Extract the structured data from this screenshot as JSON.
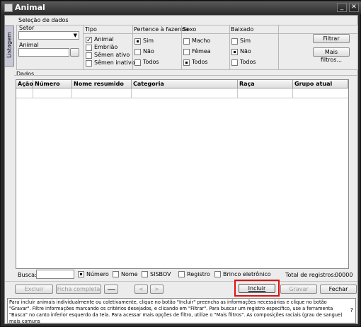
{
  "window": {
    "title": "Animal",
    "minimize": "_",
    "close": "✕"
  },
  "sidetab": {
    "label": "Listagem"
  },
  "selection": {
    "title": "Seleção de dados"
  },
  "setor": {
    "label": "Setor",
    "value": ""
  },
  "animal": {
    "label": "Animal",
    "value": ""
  },
  "tipo": {
    "label": "Tipo",
    "options": [
      {
        "label": "Animal",
        "checked": true
      },
      {
        "label": "Embrião",
        "checked": false
      },
      {
        "label": "Sêmen ativo",
        "checked": false
      },
      {
        "label": "Sêmen inativo",
        "checked": false
      }
    ]
  },
  "fazenda": {
    "label": "Pertence à fazenda",
    "options": [
      "Sim",
      "Não",
      "Todos"
    ],
    "selected": "Sim"
  },
  "sexo": {
    "label": "Sexo",
    "options": [
      "Macho",
      "Fêmea",
      "Todos"
    ],
    "selected": "Todos"
  },
  "baixado": {
    "label": "Baixado",
    "options": [
      "Sim",
      "Não",
      "Todos"
    ],
    "selected": "Não"
  },
  "actions": {
    "filtrar": "Filtrar",
    "mais_filtros": "Mais filtros..."
  },
  "dados": {
    "title": "Dados",
    "columns": [
      "Ação",
      "Número",
      "Nome resumido",
      "Categoria",
      "Raça",
      "Grupo atual"
    ]
  },
  "busca": {
    "label": "Busca:",
    "value": "",
    "options": [
      {
        "label": "Número",
        "checked": true
      },
      {
        "label": "Nome",
        "checked": false
      },
      {
        "label": "SISBOV",
        "checked": false
      },
      {
        "label": "Registro",
        "checked": false
      },
      {
        "label": "Brinco eletrônico",
        "checked": false
      }
    ],
    "total_label": "Total de registros:",
    "total_value": "00000"
  },
  "toolbar": {
    "excluir": "Excluir",
    "ficha_completa": "Ficha completa",
    "prev": "<",
    "next": ">",
    "incluir": "Incluir",
    "gravar": "Gravar",
    "fechar": "Fechar"
  },
  "help": {
    "text": "Para incluir animais individualmente ou coletivamente, clique no botão \"Incluir\" preencha as informações necessárias e clique no botão \"Gravar\". Filtre informações marcando os critérios desejados, e clicando em \"Filtrar\". Para buscar um registro específico, use a ferramenta \"Busca\" no canto inferior esquerdo da tela. Para acessar mais opções de filtro, utilize o \"Mais filtros\". As composições raciais (grau de sangue) mais comuns",
    "question": "?"
  },
  "colors": {
    "highlight": "#e01010"
  }
}
